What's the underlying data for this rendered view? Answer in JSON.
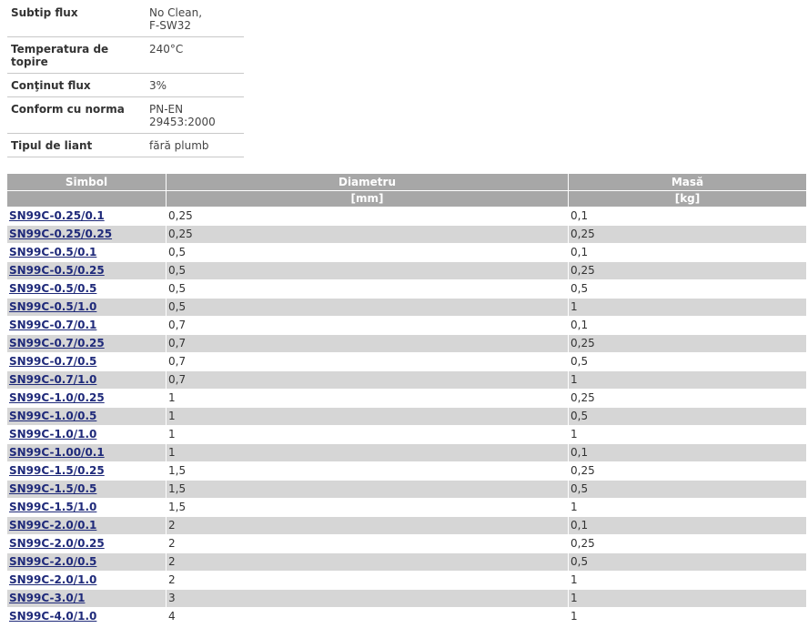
{
  "specs": [
    {
      "key": "Subtip flux",
      "value": "No Clean,\nF-SW32"
    },
    {
      "key": "Temperatura de topire",
      "value": "240°C"
    },
    {
      "key": "Conţinut flux",
      "value": "3%"
    },
    {
      "key": "Conform cu norma",
      "value": "PN-EN 29453:2000"
    },
    {
      "key": "Tipul de liant",
      "value": "fără plumb"
    }
  ],
  "table": {
    "headers": [
      "Simbol",
      "Diametru",
      "Masă"
    ],
    "units": [
      "",
      "[mm]",
      "[kg]"
    ],
    "rows": [
      {
        "symbol": "SN99C-0.25/0.1",
        "diameter": "0,25",
        "mass": "0,1"
      },
      {
        "symbol": "SN99C-0.25/0.25",
        "diameter": "0,25",
        "mass": "0,25"
      },
      {
        "symbol": "SN99C-0.5/0.1",
        "diameter": "0,5",
        "mass": "0,1"
      },
      {
        "symbol": "SN99C-0.5/0.25",
        "diameter": "0,5",
        "mass": "0,25"
      },
      {
        "symbol": "SN99C-0.5/0.5",
        "diameter": "0,5",
        "mass": "0,5"
      },
      {
        "symbol": "SN99C-0.5/1.0",
        "diameter": "0,5",
        "mass": "1"
      },
      {
        "symbol": "SN99C-0.7/0.1",
        "diameter": "0,7",
        "mass": "0,1"
      },
      {
        "symbol": "SN99C-0.7/0.25",
        "diameter": "0,7",
        "mass": "0,25"
      },
      {
        "symbol": "SN99C-0.7/0.5",
        "diameter": "0,7",
        "mass": "0,5"
      },
      {
        "symbol": "SN99C-0.7/1.0",
        "diameter": "0,7",
        "mass": "1"
      },
      {
        "symbol": "SN99C-1.0/0.25",
        "diameter": "1",
        "mass": "0,25"
      },
      {
        "symbol": "SN99C-1.0/0.5",
        "diameter": "1",
        "mass": "0,5"
      },
      {
        "symbol": "SN99C-1.0/1.0",
        "diameter": "1",
        "mass": "1"
      },
      {
        "symbol": "SN99C-1.00/0.1",
        "diameter": "1",
        "mass": "0,1"
      },
      {
        "symbol": "SN99C-1.5/0.25",
        "diameter": "1,5",
        "mass": "0,25"
      },
      {
        "symbol": "SN99C-1.5/0.5",
        "diameter": "1,5",
        "mass": "0,5"
      },
      {
        "symbol": "SN99C-1.5/1.0",
        "diameter": "1,5",
        "mass": "1"
      },
      {
        "symbol": "SN99C-2.0/0.1",
        "diameter": "2",
        "mass": "0,1"
      },
      {
        "symbol": "SN99C-2.0/0.25",
        "diameter": "2",
        "mass": "0,25"
      },
      {
        "symbol": "SN99C-2.0/0.5",
        "diameter": "2",
        "mass": "0,5"
      },
      {
        "symbol": "SN99C-2.0/1.0",
        "diameter": "2",
        "mass": "1"
      },
      {
        "symbol": "SN99C-3.0/1",
        "diameter": "3",
        "mass": "1"
      },
      {
        "symbol": "SN99C-4.0/1.0",
        "diameter": "4",
        "mass": "1"
      }
    ]
  },
  "colors": {
    "header_bg": "#a7a7a7",
    "row_alt_bg": "#d6d6d6",
    "link": "#1f2a7a"
  }
}
